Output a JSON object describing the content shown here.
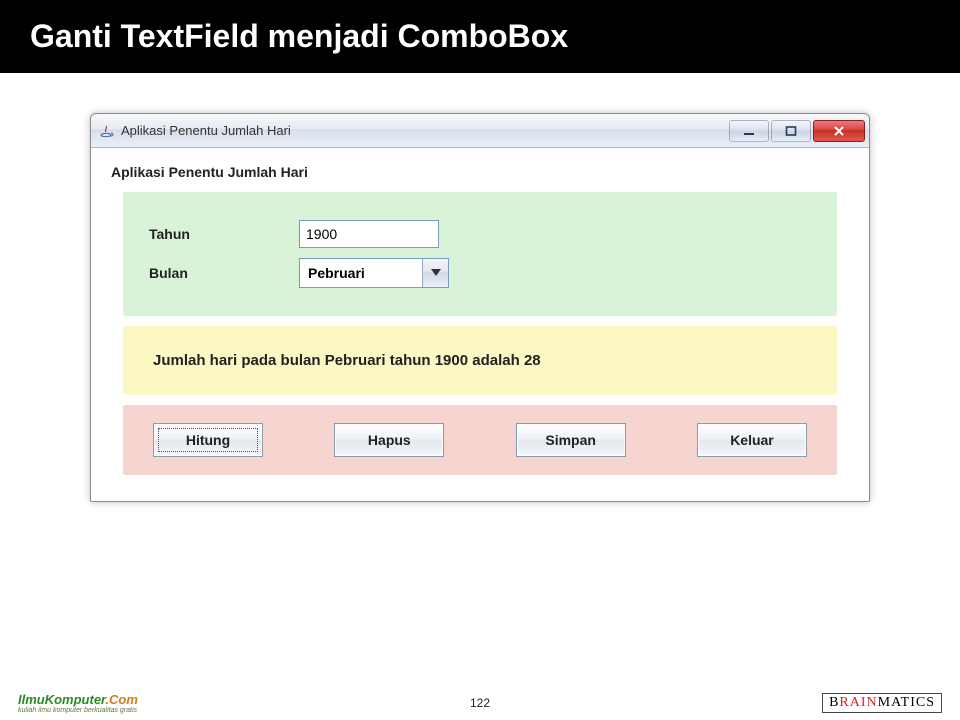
{
  "slide": {
    "title": "Ganti TextField menjadi ComboBox",
    "page_number": "122"
  },
  "footer": {
    "left_brand_a": "IlmuKomputer",
    "left_brand_b": ".Com",
    "left_tag": "kuliah ilmu komputer berkualitas gratis",
    "right_brand_pre": "B",
    "right_brand_accent": "RAIN",
    "right_brand_post": "MATICS"
  },
  "window": {
    "title": "Aplikasi Penentu Jumlah Hari",
    "group_title": "Aplikasi Penentu Jumlah Hari",
    "form": {
      "tahun_label": "Tahun",
      "tahun_value": "1900",
      "bulan_label": "Bulan",
      "bulan_value": "Pebruari"
    },
    "result": "Jumlah hari pada bulan Pebruari tahun 1900 adalah 28",
    "buttons": {
      "hitung": "Hitung",
      "hapus": "Hapus",
      "simpan": "Simpan",
      "keluar": "Keluar"
    }
  }
}
